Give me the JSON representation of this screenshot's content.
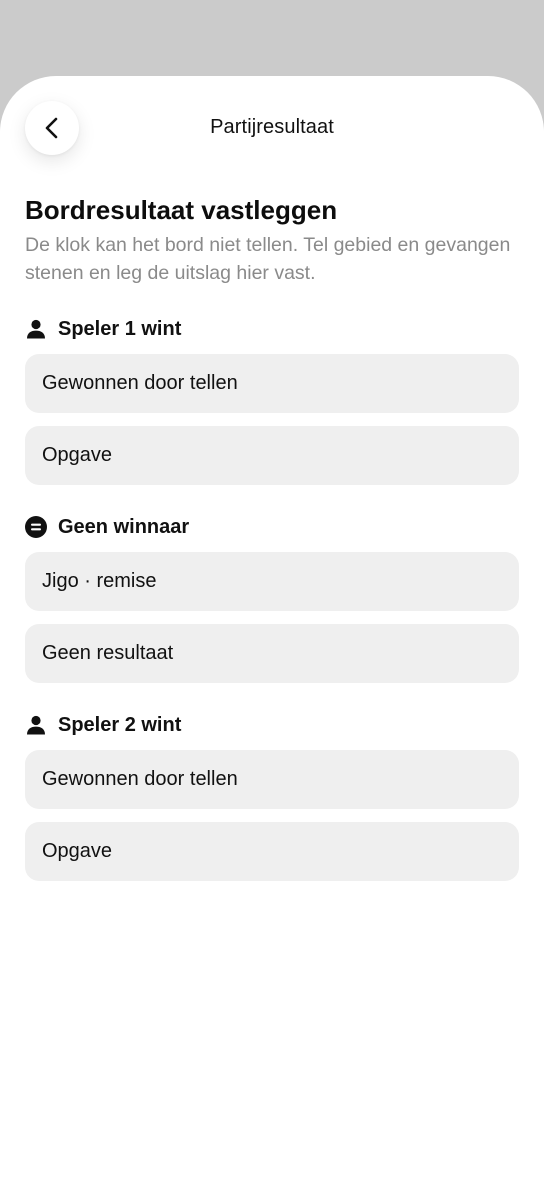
{
  "header": {
    "title": "Partijresultaat",
    "back_icon": "chevron-left-icon"
  },
  "intro": {
    "heading": "Bordresultaat vastleggen",
    "description": "De klok kan het bord niet tellen. Tel gebied en gevangen stenen en leg de uitslag hier vast."
  },
  "groups": [
    {
      "label": "Speler 1 wint",
      "icon": "person-icon",
      "options": [
        "Gewonnen door tellen",
        "Opgave"
      ]
    },
    {
      "label": "Geen winnaar",
      "icon": "equals-circle-icon",
      "options": [
        "Jigo · remise",
        "Geen resultaat"
      ]
    },
    {
      "label": "Speler 2 wint",
      "icon": "person-icon",
      "options": [
        "Gewonnen door tellen",
        "Opgave"
      ]
    }
  ],
  "colors": {
    "background_dim": "#cbcbcb",
    "sheet": "#ffffff",
    "option_fill": "#efefef",
    "secondary_text": "#8a8a8a",
    "primary_text": "#111111"
  }
}
